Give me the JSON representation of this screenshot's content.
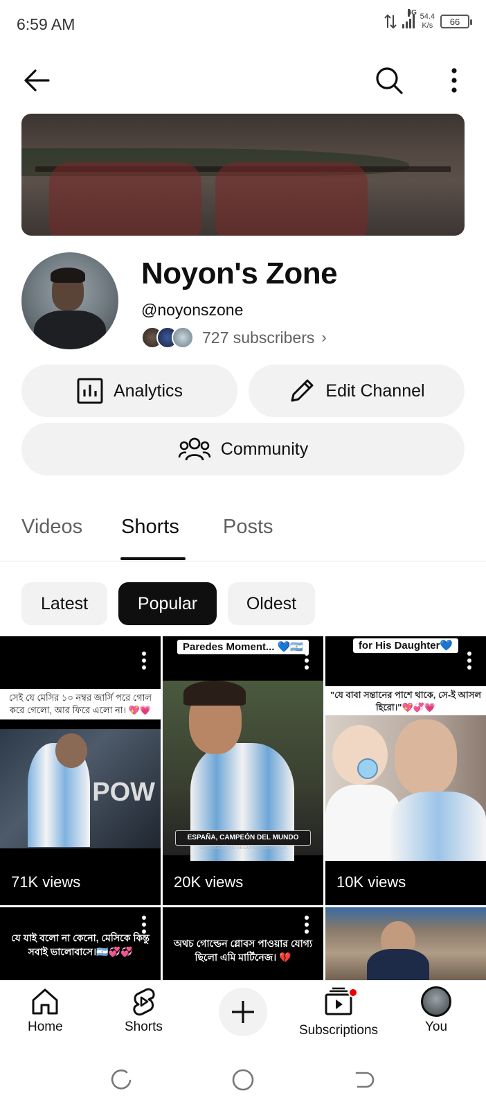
{
  "status_bar": {
    "time": "6:59 AM",
    "network": "4G",
    "net_speed_value": "54.4",
    "net_speed_unit": "K/s",
    "battery": "66"
  },
  "app_bar": {
    "back_icon": "arrow-left-icon",
    "search_icon": "search-icon",
    "more_icon": "more-vertical-icon"
  },
  "channel": {
    "name": "Noyon's Zone",
    "handle": "@noyonszone",
    "subscribers": "727 subscribers",
    "chevron": "›"
  },
  "actions": {
    "analytics": "Analytics",
    "edit_channel": "Edit Channel",
    "community": "Community"
  },
  "tabs": [
    {
      "label": "Videos",
      "active": false
    },
    {
      "label": "Shorts",
      "active": true
    },
    {
      "label": "Posts",
      "active": false
    }
  ],
  "chips": [
    {
      "label": "Latest",
      "active": false
    },
    {
      "label": "Popular",
      "active": true
    },
    {
      "label": "Oldest",
      "active": false
    }
  ],
  "shorts": [
    {
      "caption": "সেই যে মেসির ১০ নম্বর জার্সি পরে গোল করে গেলো, আর ফিরে এলো না। 💖💗",
      "views": "71K views"
    },
    {
      "top_caption": "Paredes Moment... 💙🇦🇷",
      "banner_text": "ESPAÑA, CAMPEÓN DEL MUNDO",
      "banner_sub": "CONSIGUIÓ SU SEGUNDA ESTRELLA",
      "views": "20K views"
    },
    {
      "top_caption": "for His Daughter💙",
      "caption": "\"যে বাবা সন্তানের পাশে থাকে, সে-ই আসল হিরো।\"💖💞💗",
      "views": "10K views"
    },
    {
      "caption": "যে যাই বলো না কেনো, মেসিকে কিন্তু সবাই ভালোবাসে।🇦🇷💞💞"
    },
    {
      "caption": "অথচ গোল্ডেন গ্লোবস পাওয়ার যোগ্য ছিলো এমি মার্টিনেজ। 💔"
    },
    {}
  ],
  "bottom_nav": [
    {
      "label": "Home",
      "icon": "home-icon"
    },
    {
      "label": "Shorts",
      "icon": "shorts-icon"
    },
    {
      "label": "",
      "icon": "plus-icon"
    },
    {
      "label": "Subscriptions",
      "icon": "subscriptions-icon"
    },
    {
      "label": "You",
      "icon": "avatar"
    }
  ],
  "colors": {
    "text_primary": "#0f0f0f",
    "text_secondary": "#606060",
    "pill_bg": "#f2f2f2",
    "active_chip_bg": "#0f0f0f",
    "notification_dot": "#ee0000"
  }
}
